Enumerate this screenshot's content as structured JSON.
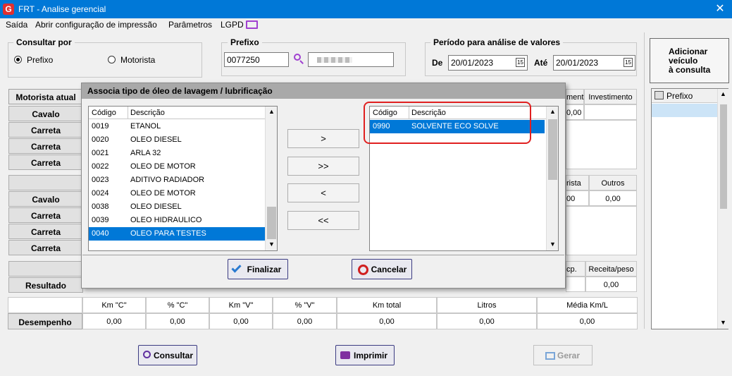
{
  "window": {
    "title": "FRT - Analise gerencial",
    "logo": "G",
    "close": "✕"
  },
  "menu": {
    "saida": "Saída",
    "config": "Abrir configuração de impressão",
    "parametros": "Parâmetros",
    "lgpd": "LGPD"
  },
  "consultar": {
    "legend": "Consultar por",
    "prefixo": "Prefixo",
    "motorista": "Motorista"
  },
  "prefixo": {
    "legend": "Prefixo",
    "value": "0077250"
  },
  "periodo": {
    "legend": "Período para análise de valores",
    "de_label": "De",
    "de": "20/01/2023",
    "ate_label": "Até",
    "ate": "20/01/2023"
  },
  "add_button": {
    "line1": "Adicionar",
    "line2": "veículo",
    "line3": "à consulta"
  },
  "right_list": {
    "header": "Prefixo"
  },
  "background": {
    "motorista_atual": "Motorista atual",
    "cavalo": "Cavalo",
    "carreta": "Carreta",
    "resultado": "Resultado",
    "hdr_mento": "mento",
    "hdr_investimento": "Investimento",
    "val_000": "0,00",
    "hdr_rista": "rista",
    "hdr_outros": "Outros",
    "val_00_partial": "00",
    "hdr_cp": "cp.",
    "hdr_receita_peso": "Receita/peso"
  },
  "desempenho": {
    "label": "Desempenho",
    "headers": [
      "Km \"C\"",
      "% \"C\"",
      "Km \"V\"",
      "% \"V\"",
      "Km total",
      "Litros",
      "Média Km/L"
    ],
    "values": [
      "0,00",
      "0,00",
      "0,00",
      "0,00",
      "0,00",
      "0,00",
      "0,00"
    ]
  },
  "dialog": {
    "title": "Associa tipo de óleo de lavagem / lubrificação",
    "col_codigo": "Código",
    "col_descricao": "Descrição",
    "left_rows": [
      {
        "codigo": "0019",
        "descricao": "ETANOL"
      },
      {
        "codigo": "0020",
        "descricao": "OLEO DIESEL"
      },
      {
        "codigo": "0021",
        "descricao": "ARLA 32"
      },
      {
        "codigo": "0022",
        "descricao": "OLEO DE MOTOR"
      },
      {
        "codigo": "0023",
        "descricao": "ADITIVO RADIADOR"
      },
      {
        "codigo": "0024",
        "descricao": "OLEO DE MOTOR"
      },
      {
        "codigo": "0038",
        "descricao": "OLEO DIESEL"
      },
      {
        "codigo": "0039",
        "descricao": "OLEO HIDRAULICO"
      },
      {
        "codigo": "0040",
        "descricao": "OLEO PARA TESTES"
      }
    ],
    "right_rows": [
      {
        "codigo": "0990",
        "descricao": "SOLVENTE ECO SOLVE"
      }
    ],
    "btn_add": ">",
    "btn_add_all": ">>",
    "btn_remove": "<",
    "btn_remove_all": "<<",
    "finalizar": "Finalizar",
    "cancelar": "Cancelar"
  },
  "bottom": {
    "consultar": "Consultar",
    "imprimir": "Imprimir",
    "gerar": "Gerar"
  },
  "colors": {
    "titlebar": "#0078d7",
    "selection": "#0078d7",
    "highlight": "#e02020"
  }
}
